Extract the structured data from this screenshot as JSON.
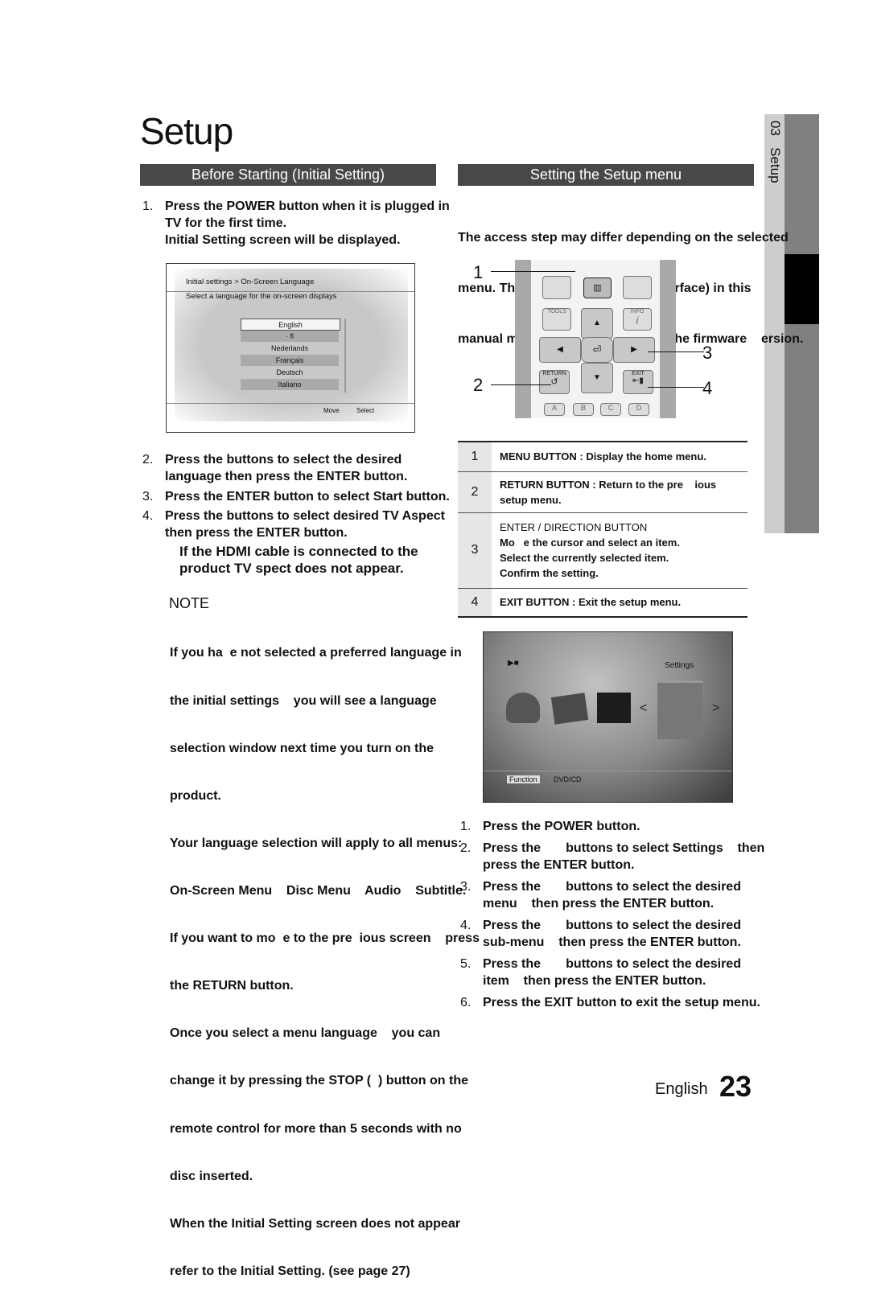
{
  "page_title": "Setup",
  "side_tab": {
    "chapter": "03",
    "label": "Setup"
  },
  "left": {
    "header": "Before Starting (Initial Setting)",
    "step1": {
      "num": "1.",
      "lines": [
        "Press the POWER button when it is plugged in",
        "TV for the first time.",
        "Initial Setting screen will be displayed."
      ]
    },
    "initial_screen": {
      "breadcrumb": "Initial settings > On-Screen Language",
      "instruction": "Select a language for the on-screen displays",
      "languages": [
        "English",
        "· fl",
        "Nederlands",
        "Français",
        "Deutsch",
        "Italiano"
      ],
      "selected": "English",
      "footer_move": "Move",
      "footer_select": "Select"
    },
    "steps": [
      {
        "num": "2.",
        "lines": [
          "Press the        buttons to select the desired",
          "language    then press the ENTER button."
        ]
      },
      {
        "num": "3.",
        "lines": [
          "Press the ENTER button to select Start button."
        ]
      },
      {
        "num": "4.",
        "lines": [
          "Press the        buttons to select desired TV Aspect",
          "then press the ENTER button."
        ]
      }
    ],
    "hdmi_note": [
      "If the HDMI cable is connected to the",
      "product    TV    spect does not appear."
    ],
    "note_title": "NOTE",
    "notes": [
      "If you ha  e not selected a preferred language in",
      "the initial settings    you will see a language",
      "selection window next time you turn on the",
      "product.",
      "Your language selection will apply to all menus:",
      "On-Screen Menu    Disc Menu    Audio    Subtitle.",
      "If you want to mo  e to the pre  ious screen    press",
      "the RETURN button.",
      "Once you select a menu language    you can",
      "change it by pressing the STOP (  ) button on the",
      "remote control for more than 5 seconds with no",
      "disc inserted.",
      "When the Initial Setting screen does not appear",
      "refer to the Initial Setting. (see page 27)"
    ]
  },
  "right": {
    "header": "Setting the Setup menu",
    "intro": [
      "The access step may differ depending on the selected",
      "menu. The GUI (Graphical User Interface) in this",
      "manual may differ    depending on the firmware    ersion."
    ],
    "remote": {
      "callouts": [
        "1",
        "2",
        "3",
        "4"
      ],
      "tools_label": "TOOLS",
      "info_label": "INFO",
      "return_label": "RETURN",
      "exit_label": "EXIT",
      "color_buttons": [
        "A",
        "B",
        "C",
        "D"
      ]
    },
    "table": [
      {
        "num": "1",
        "lines": [
          "MENU BUTTON : Display the home menu."
        ]
      },
      {
        "num": "2",
        "lines": [
          "RETURN BUTTON : Return to the pre    ious",
          "setup menu."
        ]
      },
      {
        "num": "3",
        "lines": [
          "ENTER / DIRECTION BUTTON",
          "Mo   e the cursor and select an item.",
          "Select the currently selected item.",
          "Confirm the setting."
        ]
      },
      {
        "num": "4",
        "lines": [
          "EXIT BUTTON : Exit the setup menu."
        ]
      }
    ],
    "home_screen": {
      "selected_item": "Settings",
      "function_label": "Function",
      "source": "DVD/CD"
    },
    "steps": [
      {
        "num": "1.",
        "lines": [
          "Press the POWER button."
        ]
      },
      {
        "num": "2.",
        "lines": [
          "Press the       buttons to select Settings    then",
          "press the ENTER button."
        ]
      },
      {
        "num": "3.",
        "lines": [
          "Press the       buttons to select the desired",
          "menu    then press the ENTER button."
        ]
      },
      {
        "num": "4.",
        "lines": [
          "Press the       buttons to select the desired",
          "sub-menu    then press the ENTER button."
        ]
      },
      {
        "num": "5.",
        "lines": [
          "Press the       buttons to select the desired",
          "item    then press the ENTER button."
        ]
      },
      {
        "num": "6.",
        "lines": [
          "Press the EXIT button to exit the setup menu."
        ]
      }
    ]
  },
  "footer": {
    "language": "English",
    "page_number": "23"
  }
}
